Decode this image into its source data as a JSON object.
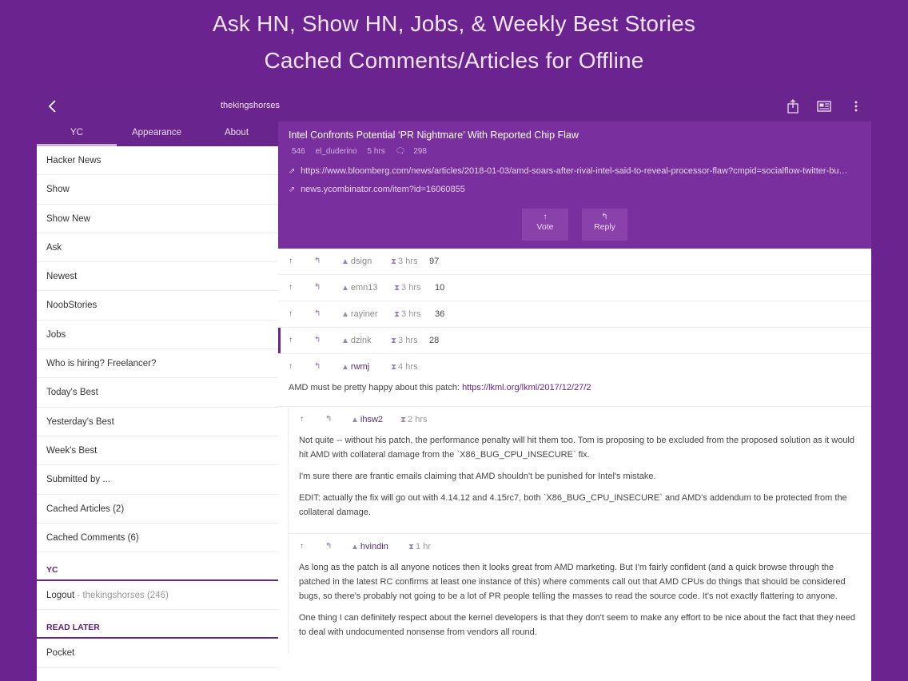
{
  "promo": {
    "line1": "Ask HN, Show HN, Jobs, & Weekly Best Stories",
    "line2": "Cached Comments/Articles for Offline"
  },
  "topbar": {
    "username": "thekingshorses"
  },
  "tabs": [
    "YC",
    "Appearance",
    "About"
  ],
  "menu": [
    "Hacker News",
    "Show",
    "Show New",
    "Ask",
    "Newest",
    "NoobStories",
    "Jobs",
    "Who is hiring? Freelancer?",
    "Today's Best",
    "Yesterday's Best",
    "Week's Best",
    "Submitted by ...",
    "Cached Articles (2)",
    "Cached Comments (6)"
  ],
  "sections": {
    "yc": "YC",
    "read_later": "READ LATER"
  },
  "logout": {
    "label": "Logout",
    "sep": " - ",
    "user": "thekingshorses (246)"
  },
  "pocket": "Pocket",
  "story": {
    "title": "Intel Confronts Potential ‘PR Nightmare’ With Reported Chip Flaw",
    "points": "546",
    "author": "el_duderino",
    "age": "5 hrs",
    "comments": "298",
    "url": "https://www.bloomberg.com/news/articles/2018-01-03/amd-soars-after-rival-intel-said-to-reveal-processor-flaw?cmpid=socialflow-twitter-bu…",
    "hn_url": "news.ycombinator.com/item?id=16060855",
    "vote_label": "Vote",
    "reply_label": "Reply"
  },
  "comments": [
    {
      "user": "dsign",
      "time": "3 hrs",
      "count": "97"
    },
    {
      "user": "emn13",
      "time": "3 hrs",
      "count": "10"
    },
    {
      "user": "rayiner",
      "time": "3 hrs",
      "count": "36"
    },
    {
      "user": "dzink",
      "time": "3 hrs",
      "count": "28"
    },
    {
      "user": "rwmj",
      "time": "4 hrs"
    }
  ],
  "rwmj_text": "AMD must be pretty happy about this patch: ",
  "rwmj_link": "https://lkml.org/lkml/2017/12/27/2",
  "replies": [
    {
      "user": "ihsw2",
      "time": "2 hrs",
      "p1": "Not quite -- without his patch, the performance penalty will hit them too. Tom is proposing to be excluded from the proposed solution as it would hit AMD with collateral damage from the `X86_BUG_CPU_INSECURE` fix.",
      "p2": "I'm sure there are frantic emails claiming that AMD shouldn't be punished for Intel's mistake.",
      "p3": "EDIT: actually the fix will go out with 4.14.12 and 4.15rc7, both `X86_BUG_CPU_INSECURE` and AMD's addendum to be protected from the collateral damage."
    },
    {
      "user": "hvindin",
      "time": "1 hr",
      "p1": "As long as the patch is all anyone notices then it looks great from AMD marketing. But I'm fairly confident (and a quick browse through the patched in the latest RC confirms at least one instance of this) where comments call out that AMD CPUs do things that should be considered bugs, so there's probably not going to be a lot of PR people telling the masses to read the source code. It's not exactly flattering to anyone.",
      "p2": "One thing I can definitely respect about the kernel developers is that they don't seem to make any effort to be nice about the fact that they need to deal with undocumented nonsense from vendors all round."
    }
  ],
  "colors": {
    "brand": "#6b2390",
    "header": "#7a2f9e"
  }
}
